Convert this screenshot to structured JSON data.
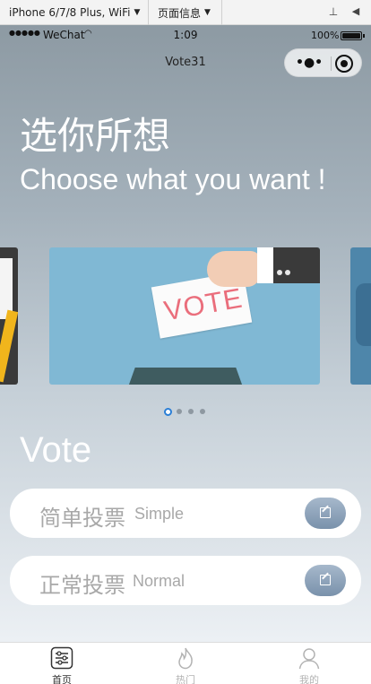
{
  "simulator": {
    "device_label": "iPhone 6/7/8 Plus, WiFi",
    "page_info_label": "页面信息"
  },
  "status_bar": {
    "carrier": "WeChat",
    "time": "1:09",
    "battery_pct": "100%",
    "battery_level": 1.0
  },
  "nav": {
    "title": "Vote31"
  },
  "hero": {
    "title_cn": "选你所想",
    "title_en": "Choose what you want !"
  },
  "carousel": {
    "main_slide_text": "VOTE",
    "page_count": 4,
    "active_index": 0
  },
  "section": {
    "title": "Vote"
  },
  "cards": [
    {
      "label_cn": "简单投票",
      "label_en": "Simple",
      "icon": "edit-icon"
    },
    {
      "label_cn": "正常投票",
      "label_en": "Normal",
      "icon": "edit-icon"
    }
  ],
  "tabbar": {
    "items": [
      {
        "label": "首页",
        "icon": "home-sliders-icon",
        "active": true
      },
      {
        "label": "热门",
        "icon": "flame-icon",
        "active": false
      },
      {
        "label": "我的",
        "icon": "user-icon",
        "active": false
      }
    ]
  },
  "colors": {
    "accent_dot": "#2b7fd6",
    "card_button": "#8ea3ba",
    "ballot_text": "#ea6e7c"
  }
}
